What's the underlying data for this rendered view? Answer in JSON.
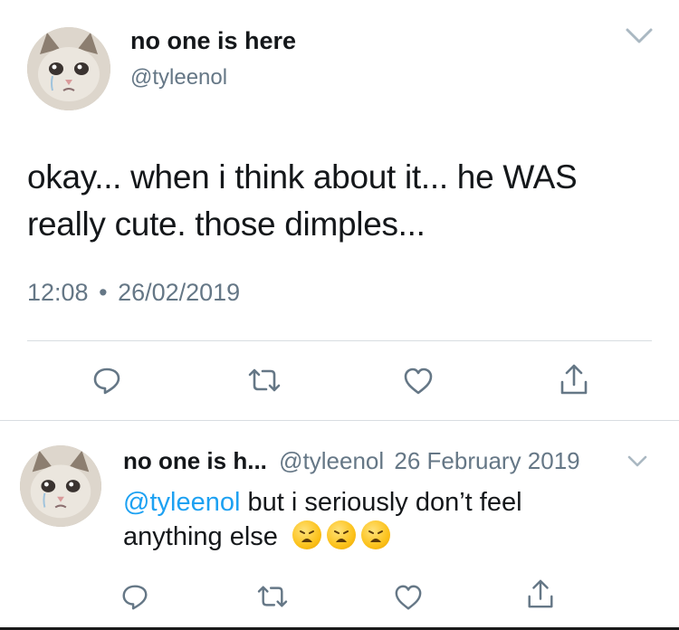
{
  "tweet": {
    "display_name": "no one is here",
    "handle": "@tyleenol",
    "text_line1": "okay... when i think about it... he WAS",
    "text_line2": "really cute. those dimples...",
    "time": "12:08",
    "separator": "•",
    "date": "26/02/2019",
    "avatar_icon": "crying-cat-avatar",
    "menu_icon": "chevron-down-icon",
    "actions": [
      "reply-icon",
      "retweet-icon",
      "like-icon",
      "share-icon"
    ]
  },
  "reply": {
    "display_name": "no one is h...",
    "handle": "@tyleenol",
    "date": "26 February 2019",
    "mention": "@tyleenol",
    "text_part1": " but i seriously don’t feel",
    "text_line2": "anything else",
    "emojis": [
      "weary-face-emoji",
      "weary-face-emoji",
      "weary-face-emoji"
    ],
    "avatar_icon": "crying-cat-avatar",
    "menu_icon": "chevron-down-icon",
    "actions": [
      "reply-icon",
      "retweet-icon",
      "like-icon",
      "share-icon"
    ]
  },
  "colors": {
    "text": "#14171a",
    "secondary": "#657786",
    "link": "#1da1f2",
    "divider": "#d8dde1"
  }
}
